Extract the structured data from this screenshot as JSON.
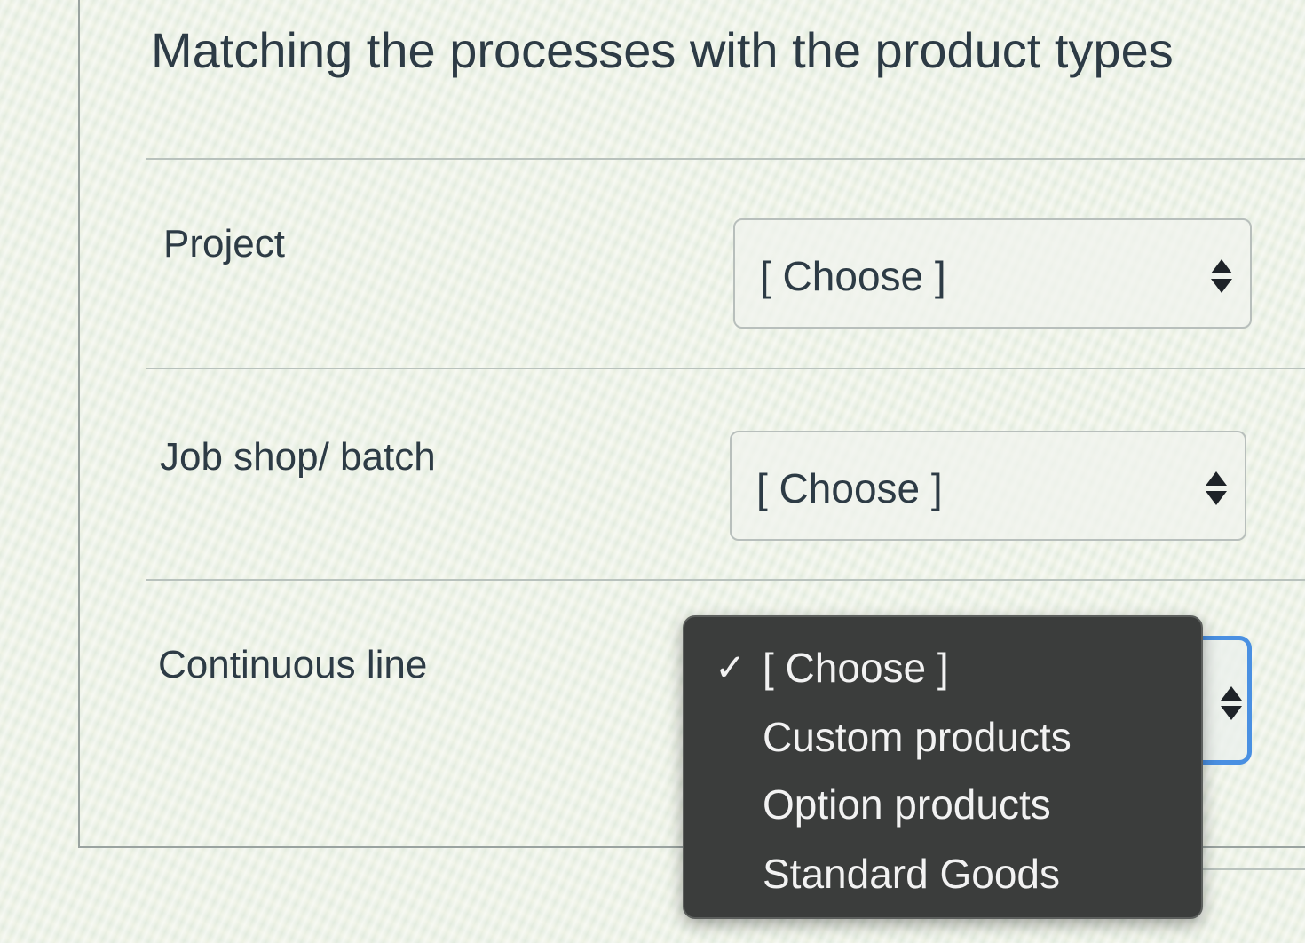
{
  "question": {
    "title": "Matching the processes with the product types"
  },
  "rows": [
    {
      "label": "Project",
      "selected": "[ Choose ]"
    },
    {
      "label": "Job shop/ batch",
      "selected": "[ Choose ]"
    },
    {
      "label": "Continuous line",
      "selected": "[ Choose ]"
    }
  ],
  "dropdown": {
    "options": [
      {
        "label": "[ Choose ]",
        "checked": true
      },
      {
        "label": "Custom products",
        "checked": false
      },
      {
        "label": "Option products",
        "checked": false
      },
      {
        "label": "Standard Goods",
        "checked": false
      }
    ],
    "check_symbol": "✓"
  },
  "colors": {
    "focus_ring": "#4a90e2",
    "dropdown_bg": "#3b3d3c",
    "text": "#2d3b45"
  },
  "icons": {
    "select_arrows": "up-down-arrows-icon",
    "check": "checkmark-icon"
  }
}
